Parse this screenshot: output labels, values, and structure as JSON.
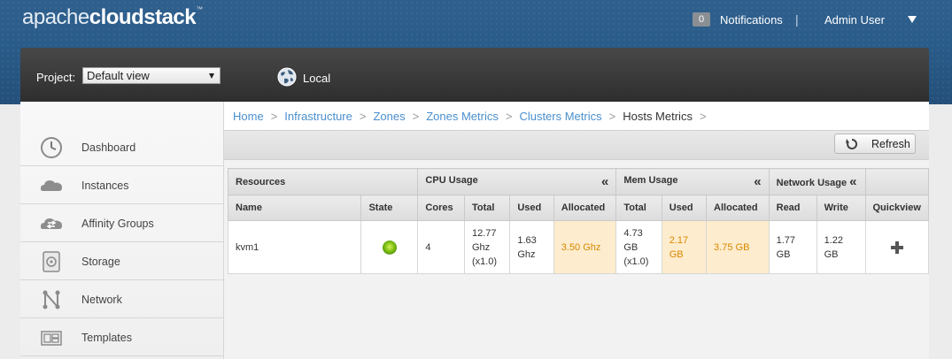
{
  "brand": {
    "part1": "apache",
    "part2": "cloudstack",
    "tm": "™"
  },
  "header": {
    "notifications_count": "0",
    "notifications_label": "Notifications",
    "separator": "|",
    "user": "Admin User"
  },
  "project": {
    "label": "Project:",
    "selected": "Default view",
    "zone_label": "Local"
  },
  "sidebar": {
    "items": [
      {
        "label": "Dashboard",
        "icon": "dashboard-icon"
      },
      {
        "label": "Instances",
        "icon": "cloud-icon"
      },
      {
        "label": "Affinity Groups",
        "icon": "affinity-icon"
      },
      {
        "label": "Storage",
        "icon": "storage-icon"
      },
      {
        "label": "Network",
        "icon": "network-icon"
      },
      {
        "label": "Templates",
        "icon": "templates-icon"
      }
    ]
  },
  "breadcrumb": {
    "items": [
      "Home",
      "Infrastructure",
      "Zones",
      "Zones Metrics",
      "Clusters Metrics",
      "Hosts Metrics"
    ],
    "sep": ">"
  },
  "toolbar": {
    "refresh_label": "Refresh"
  },
  "table": {
    "groups": {
      "resources": "Resources",
      "cpu": "CPU Usage",
      "mem": "Mem Usage",
      "network": "Network Usage",
      "collapse": "«"
    },
    "columns": {
      "name": "Name",
      "state": "State",
      "cores": "Cores",
      "cpu_total": "Total",
      "cpu_used": "Used",
      "cpu_allocated": "Allocated",
      "mem_total": "Total",
      "mem_used": "Used",
      "mem_allocated": "Allocated",
      "read": "Read",
      "write": "Write",
      "quickview": "Quickview"
    },
    "row": {
      "name": "kvm1",
      "state": "Up",
      "cores": "4",
      "cpu_total": [
        "12.77",
        "Ghz",
        "(x1.0)"
      ],
      "cpu_used": [
        "1.63",
        "Ghz"
      ],
      "cpu_allocated": "3.50 Ghz",
      "mem_total": [
        "4.73",
        "GB",
        "(x1.0)"
      ],
      "mem_used": [
        "2.17",
        "GB"
      ],
      "mem_allocated": "3.75 GB",
      "read": [
        "1.77",
        "GB"
      ],
      "write": [
        "1.22",
        "GB"
      ]
    }
  },
  "colors": {
    "warning_bg": "#fdeccd",
    "warning_text": "#d98800",
    "link": "#4a8fcc",
    "state_up": "#7cc012"
  }
}
